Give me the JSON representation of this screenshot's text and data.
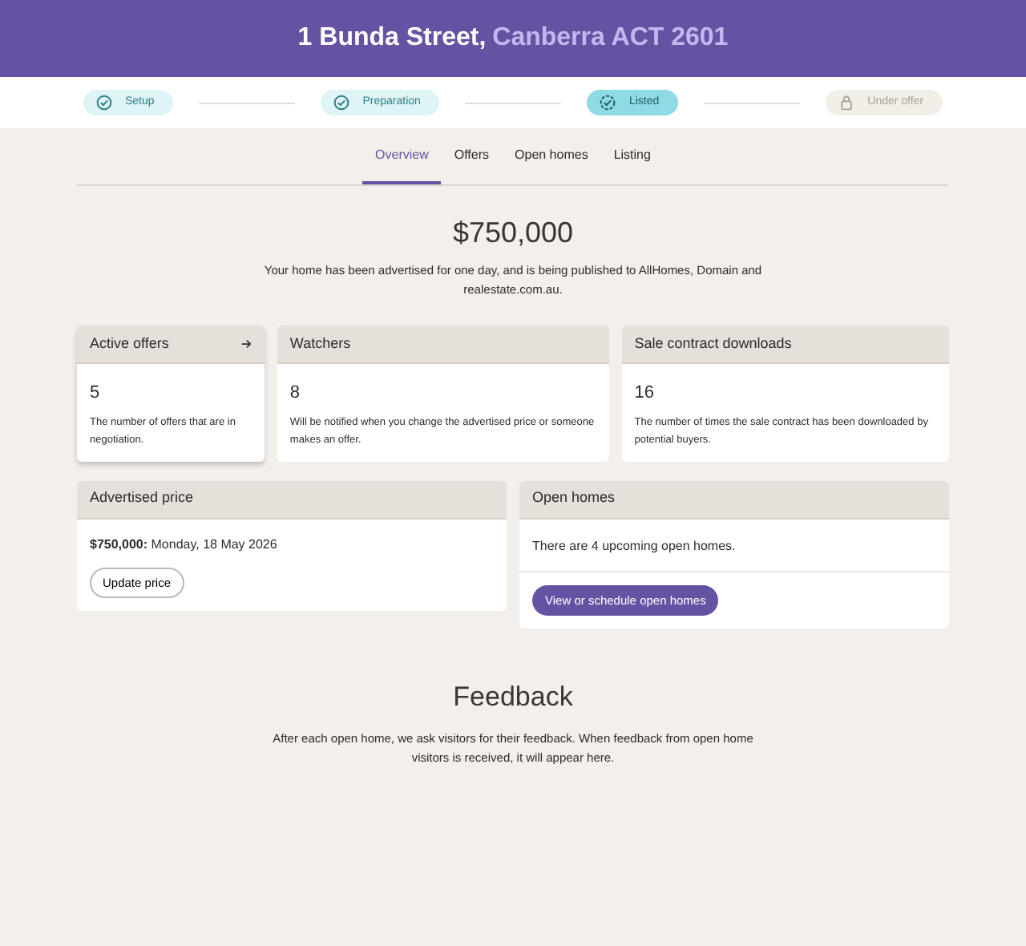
{
  "header": {
    "title": "1 Bunda Street,",
    "subtitle": "Canberra ACT 2601"
  },
  "steps": [
    {
      "label": "Setup",
      "kind": "done"
    },
    {
      "label": "Preparation",
      "kind": "done"
    },
    {
      "label": "Listed",
      "kind": "current"
    },
    {
      "label": "Under offer",
      "kind": "locked"
    }
  ],
  "tabs": [
    {
      "label": "Overview",
      "selected": true
    },
    {
      "label": "Offers",
      "selected": false
    },
    {
      "label": "Open homes",
      "selected": false
    },
    {
      "label": "Listing",
      "selected": false
    }
  ],
  "price": "$750,000",
  "summary": "Your home has been advertised for one day, and is being published to AllHomes, Domain and realestate.com.au.",
  "stats": [
    {
      "title": "Active offers",
      "value": "5",
      "description": "The number of offers that are in negotiation.",
      "link": true
    },
    {
      "title": "Watchers",
      "value": "8",
      "description": "Will be notified when you change the advertised price or someone makes an offer.",
      "link": false
    },
    {
      "title": "Sale contract downloads",
      "value": "16",
      "description": "The number of times the sale contract has been downloaded by potential buyers.",
      "link": false
    }
  ],
  "advertised_price": {
    "title": "Advertised price",
    "text": "**$750,000:** Monday, 18 May 2026",
    "button": "Update price"
  },
  "open_homes": {
    "title": "Open homes",
    "text": "There are 4 upcoming open homes.",
    "button": "View or schedule open homes"
  },
  "feedback": {
    "title": "Feedback",
    "text": "After each open home, we ask visitors for their feedback. When feedback from open home visitors is received, it will appear here."
  }
}
